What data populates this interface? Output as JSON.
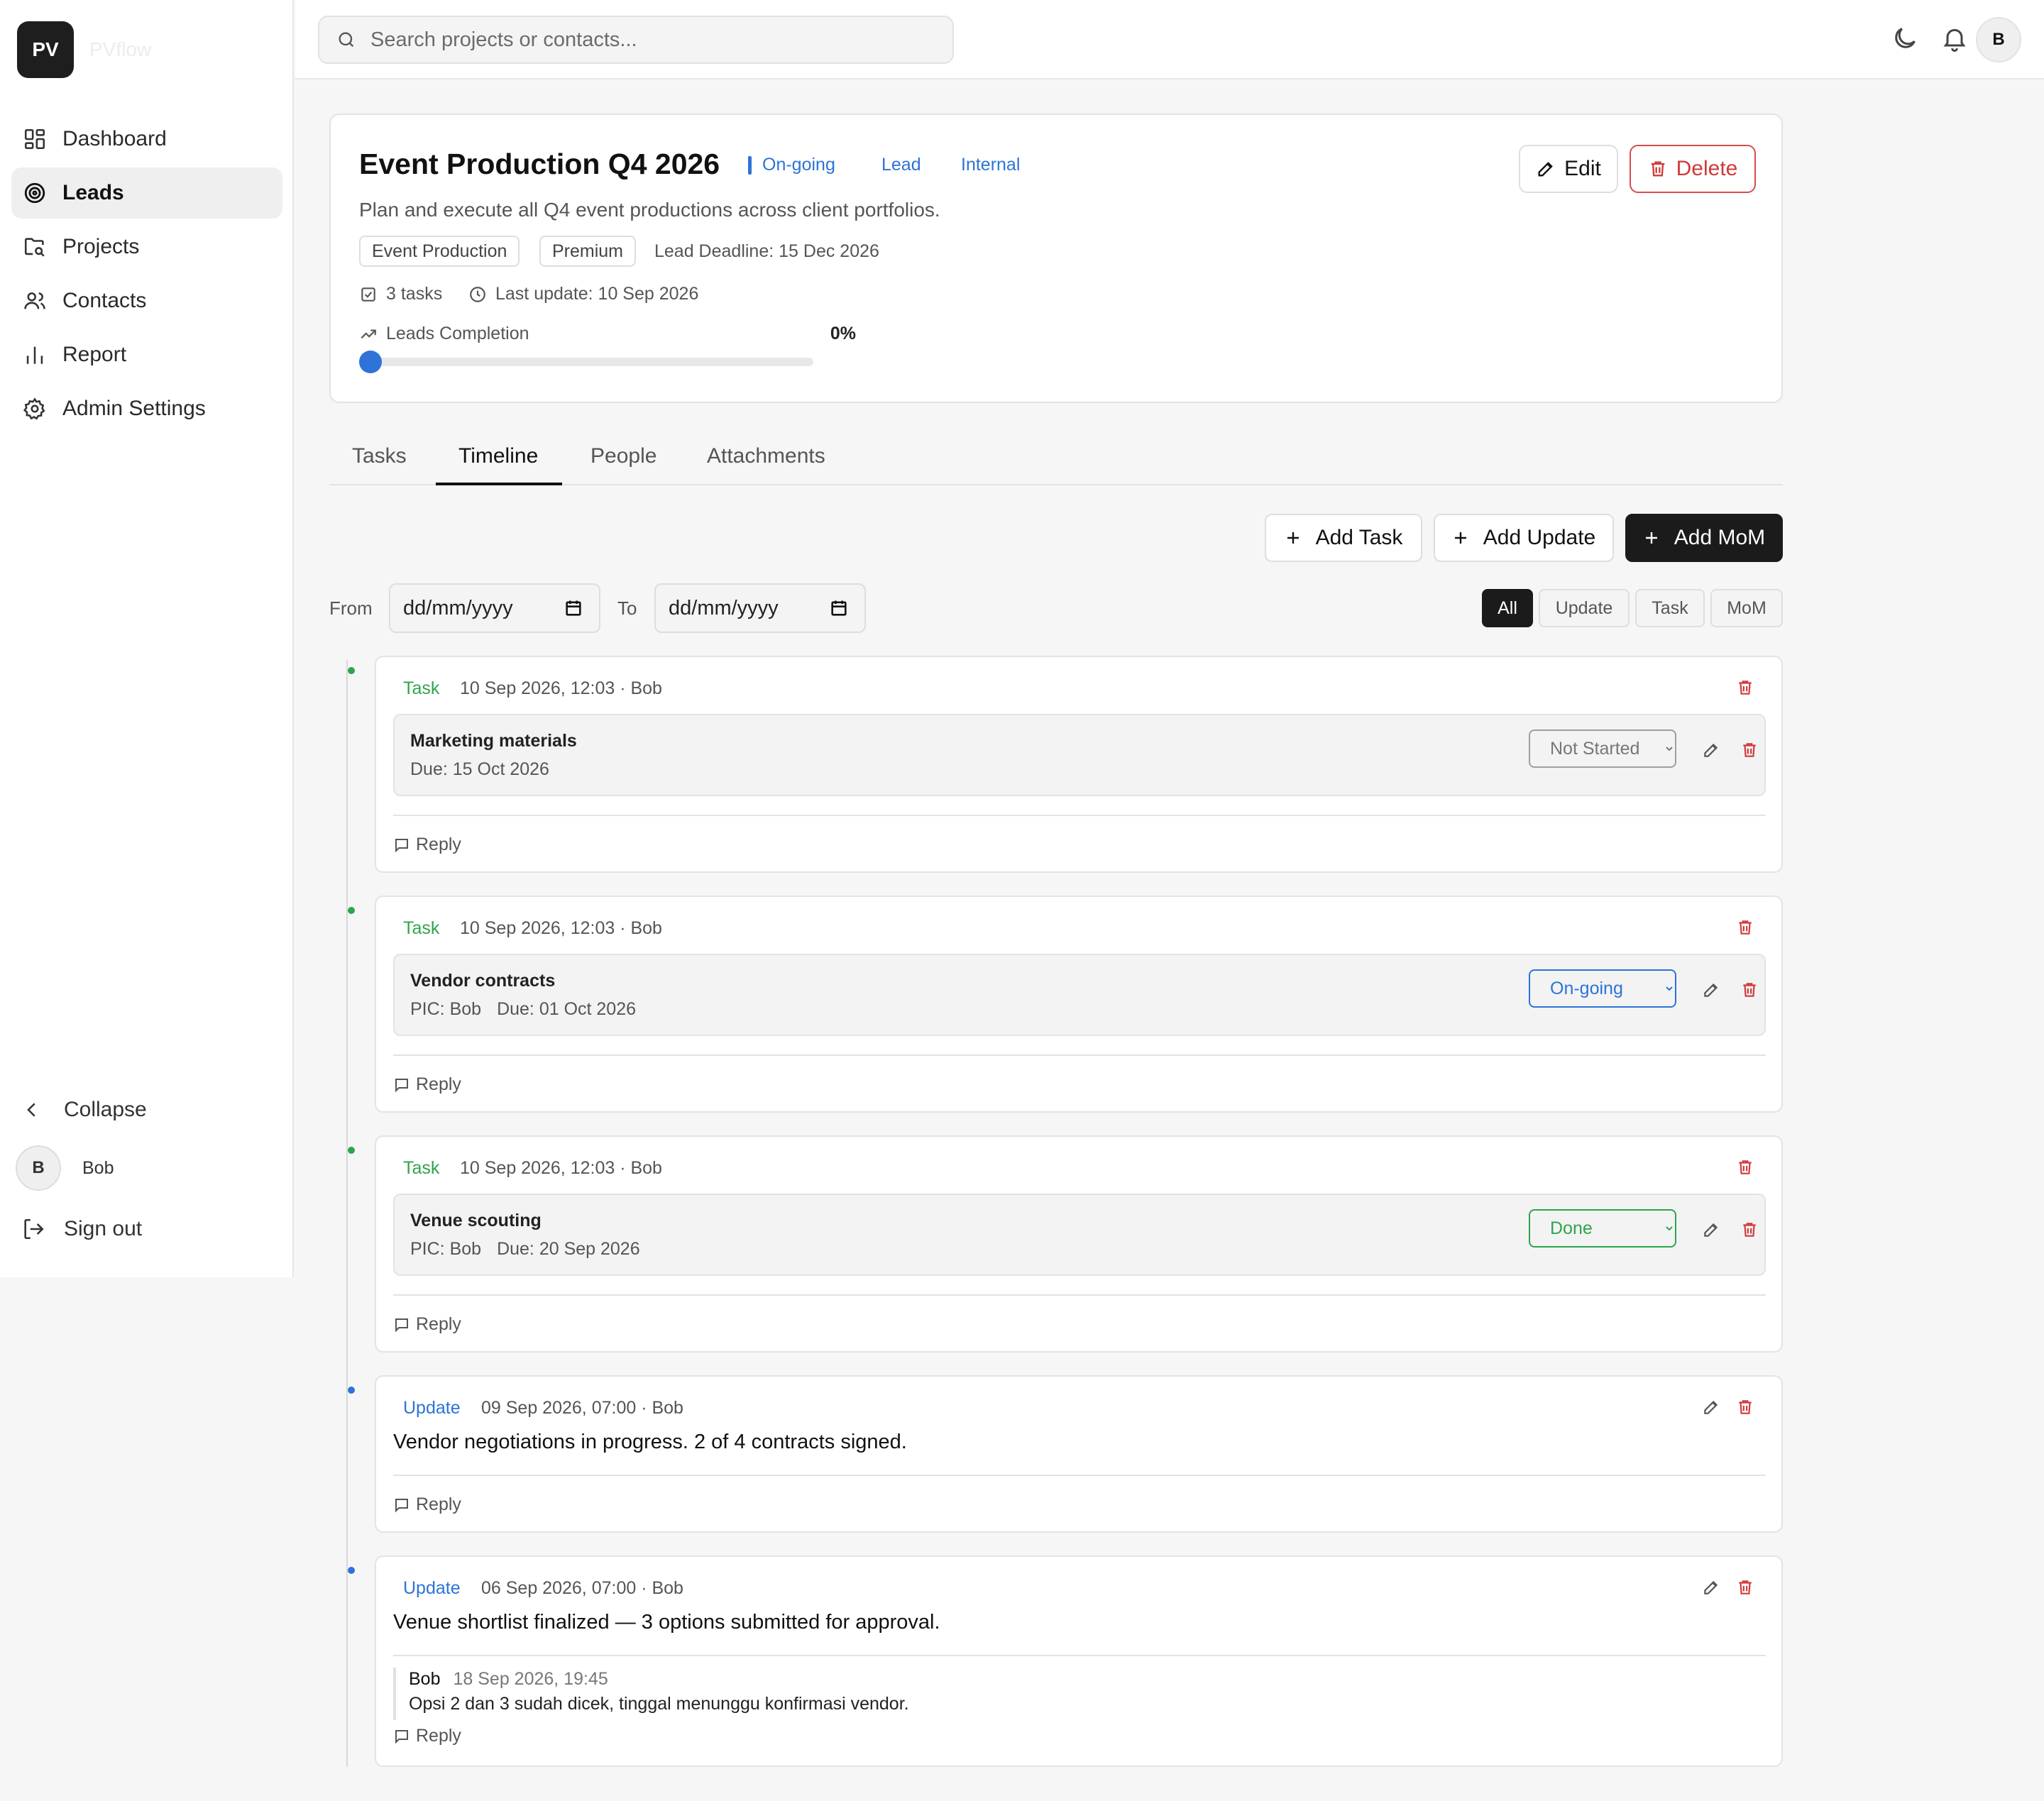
{
  "app": {
    "logo_text": "PV",
    "logo_name": "PVflow"
  },
  "sidebar": {
    "items": [
      {
        "label": "Dashboard"
      },
      {
        "label": "Leads"
      },
      {
        "label": "Projects"
      },
      {
        "label": "Contacts"
      },
      {
        "label": "Report"
      },
      {
        "label": "Admin Settings"
      }
    ],
    "collapse_label": "Collapse",
    "user_initial": "B",
    "user_name": "Bob",
    "signout_label": "Sign out"
  },
  "topbar": {
    "search_placeholder": "Search projects or contacts...",
    "avatar_initial": "B"
  },
  "project": {
    "title": "Event Production Q4 2026",
    "status": "On-going",
    "stage": "Lead",
    "scope": "Internal",
    "edit_label": "Edit",
    "delete_label": "Delete",
    "description": "Plan and execute all Q4 event productions across client portfolios.",
    "tags": [
      "Event Production",
      "Premium"
    ],
    "deadline": "Lead Deadline: 15 Dec 2026",
    "tasks_count": "3 tasks",
    "last_update": "Last update: 10 Sep 2026",
    "completion_label": "Leads Completion",
    "completion_pct": "0%",
    "completion_value": 0
  },
  "tabs": [
    {
      "label": "Tasks"
    },
    {
      "label": "Timeline"
    },
    {
      "label": "People"
    },
    {
      "label": "Attachments"
    }
  ],
  "actions": {
    "add_task": "Add Task",
    "add_update": "Add Update",
    "add_mom": "Add MoM"
  },
  "filters": {
    "from_label": "From",
    "to_label": "To",
    "date_placeholder": "dd/mm/yyyy",
    "types": [
      "All",
      "Update",
      "Task",
      "MoM"
    ]
  },
  "timeline": {
    "reply_label": "Reply",
    "entries": [
      {
        "type": "Task",
        "meta": "10 Sep 2026, 12:03 · Bob",
        "task_name": "Marketing materials",
        "pic": "",
        "due": "Due: 15 Oct 2026",
        "status": "Not Started"
      },
      {
        "type": "Task",
        "meta": "10 Sep 2026, 12:03 · Bob",
        "task_name": "Vendor contracts",
        "pic": "PIC: Bob",
        "due": "Due: 01 Oct 2026",
        "status": "On-going"
      },
      {
        "type": "Task",
        "meta": "10 Sep 2026, 12:03 · Bob",
        "task_name": "Venue scouting",
        "pic": "PIC: Bob",
        "due": "Due: 20 Sep 2026",
        "status": "Done"
      },
      {
        "type": "Update",
        "meta": "09 Sep 2026, 07:00 · Bob",
        "text": "Vendor negotiations in progress. 2 of 4 contracts signed."
      },
      {
        "type": "Update",
        "meta": "06 Sep 2026, 07:00 · Bob",
        "text": "Venue shortlist finalized — 3 options submitted for approval.",
        "comment": {
          "author": "Bob",
          "time": "18 Sep 2026, 19:45",
          "text": "Opsi 2 dan 3 sudah dicek, tinggal menunggu konfirmasi vendor."
        }
      }
    ]
  },
  "colors": {
    "accent_blue": "#2d73d8",
    "task_green": "#2ea44f",
    "danger_red": "#d03a3a",
    "dark": "#1b1b1b"
  }
}
